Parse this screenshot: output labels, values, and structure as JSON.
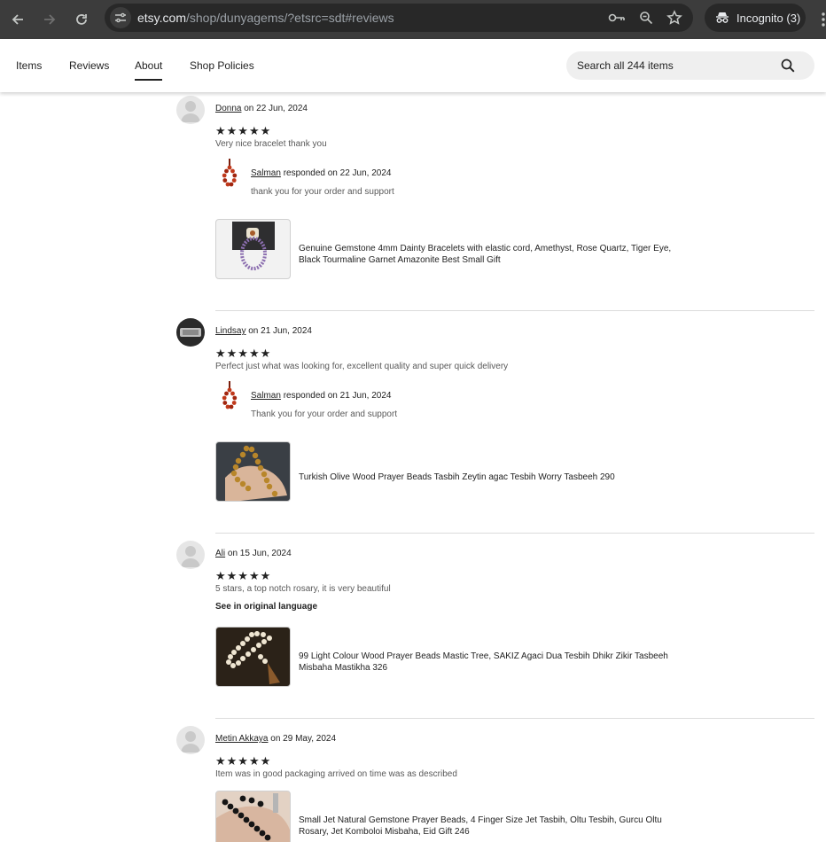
{
  "browser": {
    "url_host": "etsy.com",
    "url_path": "/shop/dunyagems/?etsrc=sdt#reviews",
    "incognito_label": "Incognito (3)"
  },
  "shop_nav": {
    "tabs": [
      {
        "label": "Items",
        "active": false
      },
      {
        "label": "Reviews",
        "active": false
      },
      {
        "label": "About",
        "active": true
      },
      {
        "label": "Shop Policies",
        "active": false
      }
    ],
    "search_placeholder": "Search all 244 items"
  },
  "reviews": [
    {
      "reviewer": "Donna",
      "date": "on 22 Jun, 2024",
      "stars": "★★★★★",
      "rating": 5,
      "text": "Very nice bracelet thank you",
      "response": {
        "author": "Salman",
        "date": "responded on 22 Jun, 2024",
        "text": "thank you for your order and support"
      },
      "item_title": "Genuine Gemstone 4mm Dainty Bracelets with elastic cord, Amethyst, Rose Quartz, Tiger Eye, Black Tourmaline Garnet Amazonite Best Small Gift"
    },
    {
      "reviewer": "Lindsay",
      "date": "on 21 Jun, 2024",
      "stars": "★★★★★",
      "rating": 5,
      "text": "Perfect just what was looking for, excellent quality and super quick delivery",
      "response": {
        "author": "Salman",
        "date": "responded on 21 Jun, 2024",
        "text": "Thank you for your order and support"
      },
      "item_title": "Turkish Olive Wood Prayer Beads Tasbih Zeytin agac Tesbih Worry Tasbeeh 290"
    },
    {
      "reviewer": "Ali",
      "date": "on 15 Jun, 2024",
      "stars": "★★★★★",
      "rating": 5,
      "text": "5 stars, a top notch rosary, it is very beautiful",
      "translate_label": "See in original language",
      "item_title": "99 Light Colour Wood Prayer Beads Mastic Tree, SAKIZ Agaci Dua Tesbih Dhikr Zikir Tasbeeh Misbaha Mastikha 326"
    },
    {
      "reviewer": "Metin Akkaya",
      "date": "on 29 May, 2024",
      "stars": "★★★★★",
      "rating": 5,
      "text": "Item was in good packaging arrived on time was as described",
      "item_title": "Small Jet Natural Gemstone Prayer Beads, 4 Finger Size Jet Tasbih, Oltu Tesbih, Gurcu Oltu Rosary, Jet Komboloi Misbaha, Eid Gift 246"
    }
  ]
}
